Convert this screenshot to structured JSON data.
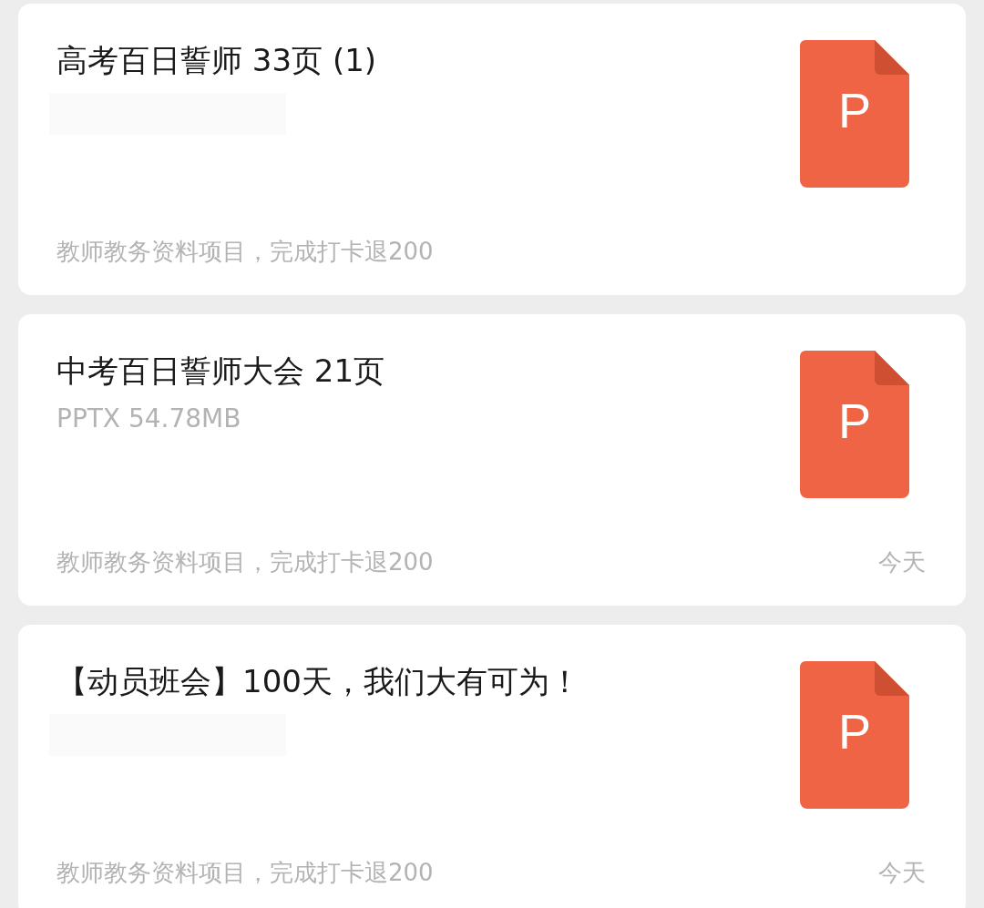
{
  "files": [
    {
      "title": "高考百日誓师 33页 (1)",
      "subtitle_hidden": true,
      "icon_letter": "P",
      "note": "教师教务资料项目，完成打卡退200"
    },
    {
      "title": "中考百日誓师大会 21页",
      "subtitle_hidden": false,
      "subtitle": "PPTX 54.78MB",
      "icon_letter": "P",
      "note": "教师教务资料项目，完成打卡退200",
      "date": "今天"
    },
    {
      "title": "【动员班会】100天，我们大有可为！",
      "subtitle_hidden": true,
      "icon_letter": "P",
      "note": "教师教务资料项目，完成打卡退200",
      "date": "今天"
    }
  ]
}
